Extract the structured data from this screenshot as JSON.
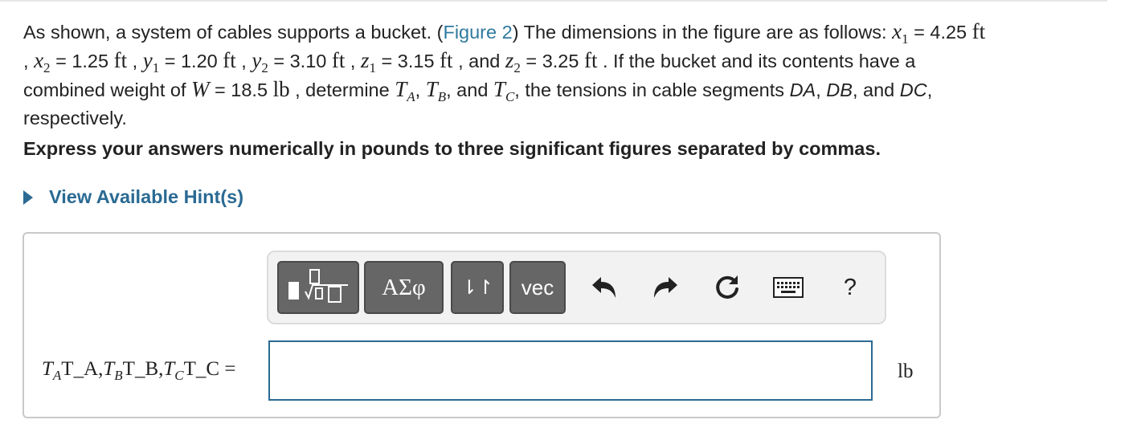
{
  "problem": {
    "l1_a": "As shown, a system of cables supports a bucket. (",
    "figure_link": "Figure 2",
    "l1_b": ") The dimensions in the figure are as follows: ",
    "x": "x",
    "one": "1",
    "two": "2",
    "eq_425": " = 4.25 ",
    "ft": "ft",
    "comma": " ,",
    "eq_125": " = 1.25 ",
    "y": "y",
    "eq_120": " = 1.20 ",
    "eq_310": " = 3.10 ",
    "z": "z",
    "eq_315": " = 3.15 ",
    "and": " , and ",
    "eq_325": " = 3.25 ",
    "l2_end": " . If the bucket and its contents have a",
    "l3_a": "combined weight of ",
    "W": "W",
    "eq_185": " = 18.5 ",
    "lb": "lb",
    "l3_b": " , determine ",
    "T": "T",
    "A": "A",
    "B": "B",
    "C": "C",
    "sep": ", ",
    "and2": ", and ",
    "l3_c": ", the tensions in cable segments ",
    "DA": "DA",
    "DB": "DB",
    "DC": "DC",
    "c2": ", ",
    "and3": ", and ",
    "dot_comma": ",",
    "l4": "respectively."
  },
  "instruction": "Express your answers numerically in pounds to three significant figures separated by commas.",
  "hint": {
    "label": "View Available Hint(s)"
  },
  "toolbar": {
    "greek_label": "ΑΣφ",
    "updown_label": "⇂↾",
    "vec_label": "vec",
    "help_label": "?"
  },
  "answer": {
    "var_label_text": "T_A,T_B,T_C =",
    "T": "T",
    "A": "A",
    "B": "B",
    "C": "C",
    "raw1": "T_A,",
    "raw2": "T_B,",
    "raw3": "T_C =",
    "value": "",
    "unit": "lb"
  },
  "colors": {
    "link": "#2f7a9e",
    "hint": "#2a6a93",
    "button": "#666666",
    "field_border": "#2a6a93"
  }
}
